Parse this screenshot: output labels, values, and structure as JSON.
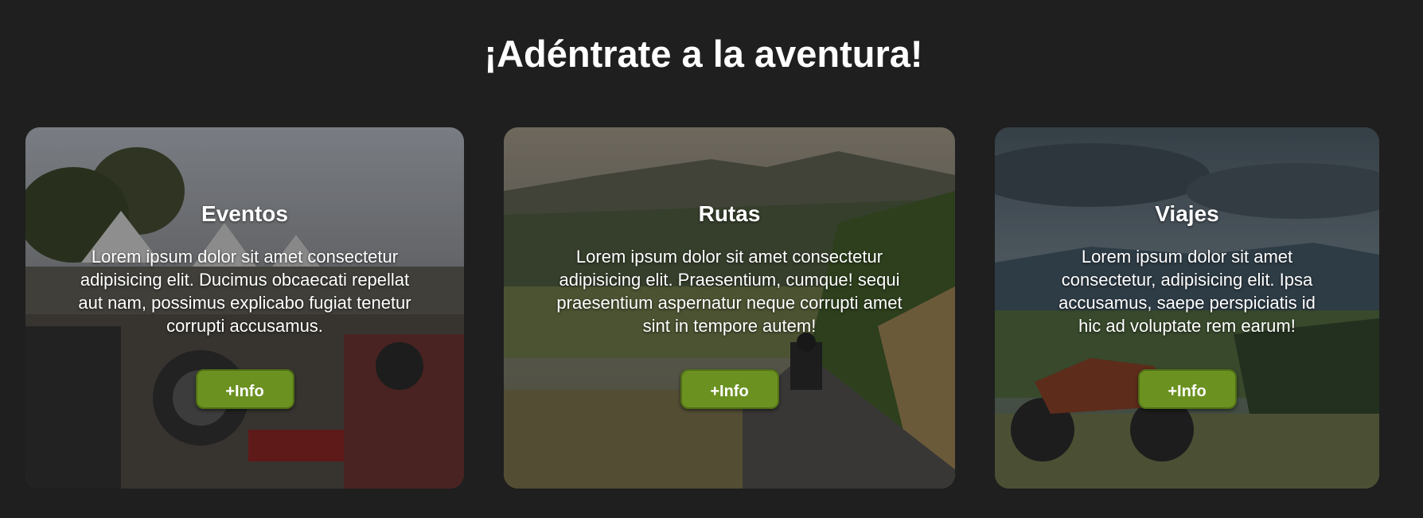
{
  "header": {
    "title": "¡Adéntrate a la aventura!"
  },
  "cards": [
    {
      "title": "Eventos",
      "text": "Lorem ipsum dolor sit amet consectetur adipisicing elit. Ducimus obcaecati repellat aut nam, possimus explicabo fugiat tenetur corrupti accusamus.",
      "button_label": "+Info"
    },
    {
      "title": "Rutas",
      "text": "Lorem ipsum dolor sit amet consectetur adipisicing elit. Praesentium, cumque! sequi praesentium aspernatur neque corrupti amet sint in tempore autem!",
      "button_label": "+Info"
    },
    {
      "title": "Viajes",
      "text": "Lorem ipsum dolor sit amet consectetur, adipisicing elit. Ipsa accusamus, saepe perspiciatis id hic ad voluptate rem earum!",
      "button_label": "+Info"
    }
  ],
  "colors": {
    "background": "#1f1f1f",
    "button": "#6b9121",
    "text": "#ffffff"
  }
}
